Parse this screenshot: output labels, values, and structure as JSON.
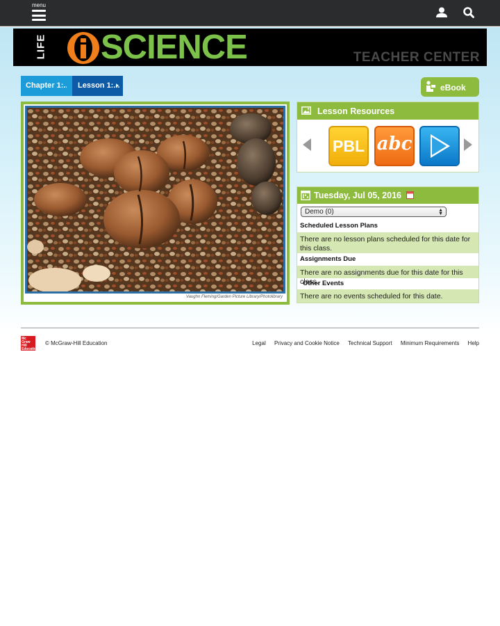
{
  "nav": {
    "menu_label": "menu"
  },
  "banner": {
    "life": "LIFE",
    "science": "SCIENCE",
    "subtitle": "TEACHER CENTER"
  },
  "breadcrumb": {
    "chapter": "Chapter 1:...",
    "lesson": "Lesson 1:..."
  },
  "ebook_label": "eBook",
  "photo": {
    "credit": "Vaughn Fleming/Garden Picture Library/Photolibrary"
  },
  "resources": {
    "title": "Lesson Resources",
    "tiles": [
      {
        "label": "PBL",
        "color": "#f5c518"
      },
      {
        "label": "abc",
        "color": "#f58220"
      },
      {
        "label": "video",
        "color": "#1a8fdc"
      }
    ]
  },
  "calendar": {
    "date": "Tuesday, Jul 05, 2016",
    "class_select": "Demo (0)",
    "sections": {
      "lesson_plans_label": "Scheduled Lesson Plans",
      "lesson_plans_text": "There are no lesson plans scheduled for this date for this class.",
      "assignments_label": "Assignments Due",
      "assignments_text": "There are no assignments due for this date for this class.",
      "events_label": "Other Events",
      "events_text": "There are no events scheduled for this date."
    }
  },
  "footer": {
    "logo_text": "Mc Graw Hill Education",
    "copyright": "© McGraw-Hill Education",
    "links": [
      "Legal",
      "Privacy and Cookie Notice",
      "Technical Support",
      "Minimum Requirements",
      "Help"
    ]
  },
  "colors": {
    "topbar": "#2b2c2e",
    "accent_green": "#8cbb3d",
    "science_green": "#7cc24a",
    "breadcrumb_light": "#1c9cd8",
    "breadcrumb_dark": "#0d5aa7",
    "row_green": "#d5e7b3"
  }
}
